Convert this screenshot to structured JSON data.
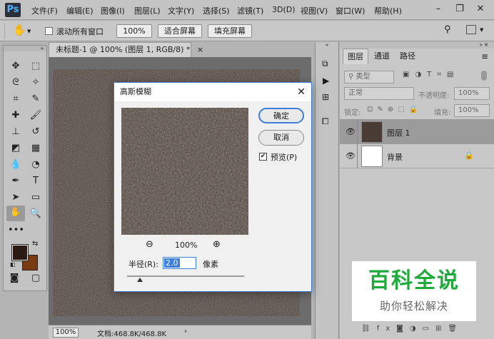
{
  "menubar": {
    "logo": "Ps",
    "items": [
      "文件(F)",
      "编辑(E)",
      "图像(I)",
      "图层(L)",
      "文字(Y)",
      "选择(S)",
      "滤镜(T)",
      "3D(D)",
      "视图(V)",
      "窗口(W)",
      "帮助(H)"
    ]
  },
  "options": {
    "scroll_all_label": "滚动所有窗口",
    "zoom_value": "100%",
    "fit_screen": "适合屏幕",
    "fill_screen": "填充屏幕"
  },
  "document": {
    "tab_title": "未标题-1 @ 100% (图层 1, RGB/8) *",
    "tab_close": "×",
    "status_zoom": "100%",
    "status_doc": "文档:468.8K/468.8K",
    "canvas_base": "#4a3c34"
  },
  "layers_panel": {
    "tabs": [
      "图层",
      "通道",
      "路径"
    ],
    "kind_filter": "类型",
    "blend_mode": "正常",
    "opacity_label": "不透明度:",
    "opacity_value": "100%",
    "lock_label": "锁定:",
    "fill_label": "填充:",
    "fill_value": "100%",
    "layers": [
      {
        "name": "图层 1",
        "selected": true
      },
      {
        "name": "背景",
        "selected": false
      }
    ]
  },
  "dialog": {
    "title": "高斯模糊",
    "ok": "确定",
    "cancel": "取消",
    "preview_label": "预览(P)",
    "preview_checked": true,
    "zoom_value": "100%",
    "radius_label": "半径(R):",
    "radius_value": "2.0",
    "radius_unit": "像素",
    "slider_fraction": 0.11
  },
  "watermark": {
    "main": "百科全说",
    "sub": "助你轻松解决",
    "color": "#1faa3c"
  },
  "colors": {
    "foreground": "#2a1a12",
    "background": "#7a3b12"
  }
}
